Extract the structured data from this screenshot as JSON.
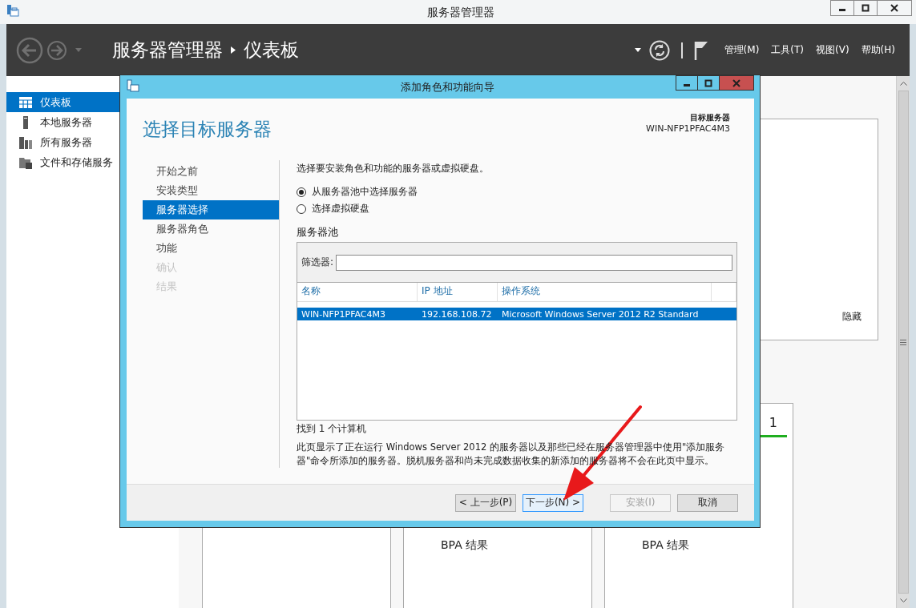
{
  "window": {
    "title": "服务器管理器"
  },
  "header": {
    "breadcrumb": [
      "服务器管理器",
      "仪表板"
    ],
    "menus": [
      "管理(M)",
      "工具(T)",
      "视图(V)",
      "帮助(H)"
    ]
  },
  "sidebar": {
    "items": [
      {
        "label": "仪表板",
        "kind": "dashboard",
        "selected": true
      },
      {
        "label": "本地服务器",
        "kind": "server",
        "selected": false
      },
      {
        "label": "所有服务器",
        "kind": "servers",
        "selected": false
      },
      {
        "label": "文件和存储服务",
        "kind": "storage",
        "selected": false
      }
    ]
  },
  "top_tile": {
    "link": "隐藏"
  },
  "tiles": [
    {
      "label": "BPA 结果"
    },
    {
      "count": "1",
      "label": "BPA 结果"
    }
  ],
  "dialog": {
    "title": "添加角色和功能向导",
    "heading": "选择目标服务器",
    "target_label": "目标服务器",
    "target_value": "WIN-NFP1PFAC4M3",
    "steps": [
      {
        "label": "开始之前",
        "selected": false,
        "disabled": false
      },
      {
        "label": "安装类型",
        "selected": false,
        "disabled": false
      },
      {
        "label": "服务器选择",
        "selected": true,
        "disabled": false
      },
      {
        "label": "服务器角色",
        "selected": false,
        "disabled": false
      },
      {
        "label": "功能",
        "selected": false,
        "disabled": false
      },
      {
        "label": "确认",
        "selected": false,
        "disabled": true
      },
      {
        "label": "结果",
        "selected": false,
        "disabled": true
      }
    ],
    "description": "选择要安装角色和功能的服务器或虚拟硬盘。",
    "options": [
      {
        "label": "从服务器池中选择服务器",
        "selected": true
      },
      {
        "label": "选择虚拟硬盘",
        "selected": false
      }
    ],
    "pool": {
      "title": "服务器池",
      "filter_label": "筛选器:",
      "columns": [
        "名称",
        "IP 地址",
        "操作系统"
      ],
      "rows": [
        {
          "cells": [
            "WIN-NFP1PFAC4M3",
            "192.168.108.72",
            "Microsoft Windows Server 2012 R2 Standard"
          ],
          "selected": true
        }
      ]
    },
    "found": "找到 1 个计算机",
    "note": "此页显示了正在运行 Windows Server 2012 的服务器以及那些已经在服务器管理器中使用\"添加服务器\"命令所添加的服务器。脱机服务器和尚未完成数据收集的新添加的服务器将不会在此页中显示。",
    "buttons": [
      {
        "label": "< 上一步(P)",
        "disabled": false,
        "focused": false
      },
      {
        "label": "下一步(N) >",
        "disabled": false,
        "focused": true
      },
      {
        "label": "安装(I)",
        "disabled": true,
        "focused": false
      },
      {
        "label": "取消",
        "disabled": false,
        "focused": false
      }
    ]
  }
}
